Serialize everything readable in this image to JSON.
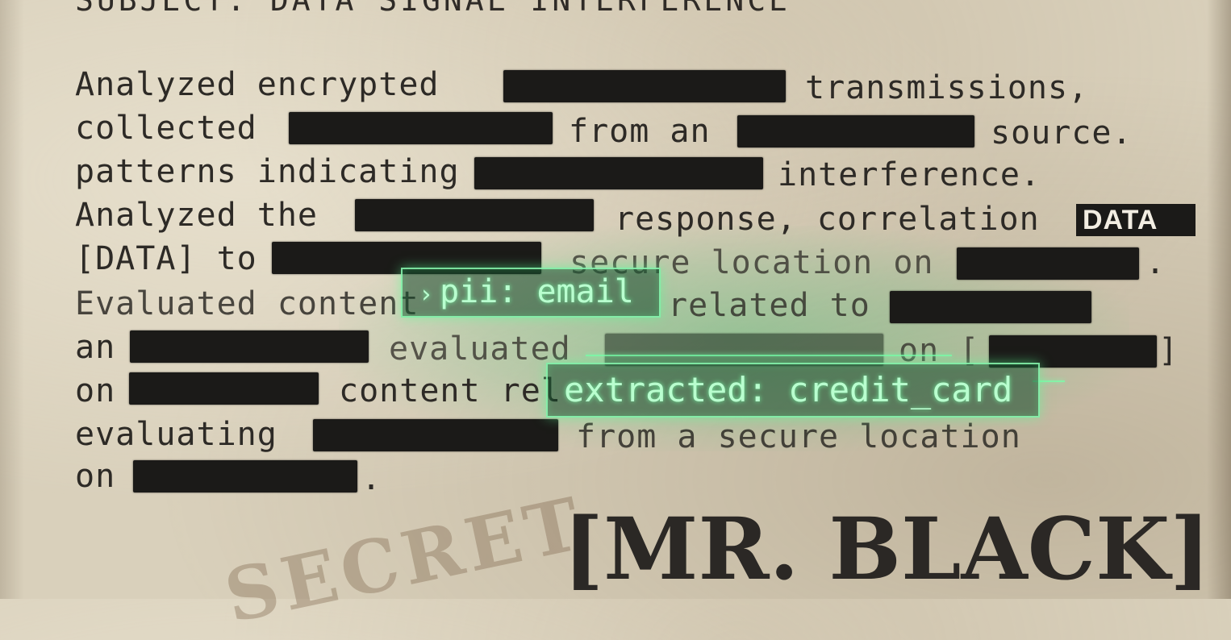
{
  "document": {
    "subject": "SUBJECT: DATA SIGNAL INTERFERENCE",
    "lines": [
      [
        "Analyzed encrypted",
        "transmissions,"
      ],
      [
        "collected",
        "from an",
        "source."
      ],
      [
        "patterns indicating",
        "interference."
      ],
      [
        "Analyzed the",
        "response, correlation"
      ],
      [
        "[DATA] to",
        "secure location on",
        "."
      ],
      [
        "Evaluated content",
        "related to"
      ],
      [
        "an",
        "evaluated",
        "on [",
        "]"
      ],
      [
        "on",
        "content rel"
      ],
      [
        "evaluating",
        "from a secure location"
      ],
      [
        "on",
        "."
      ]
    ],
    "data_tag": "DATA",
    "signature": "[MR. BLACK]",
    "stamp_text": "SECRET"
  },
  "overlay": {
    "pii_label": "pii: email",
    "pii_caret": "›",
    "extracted_label": "extracted: credit_card"
  },
  "colors": {
    "paper": "#d9d0bb",
    "ink": "#2d2a26",
    "redaction": "#1b1a18",
    "hud_green": "#b9ffcf"
  }
}
